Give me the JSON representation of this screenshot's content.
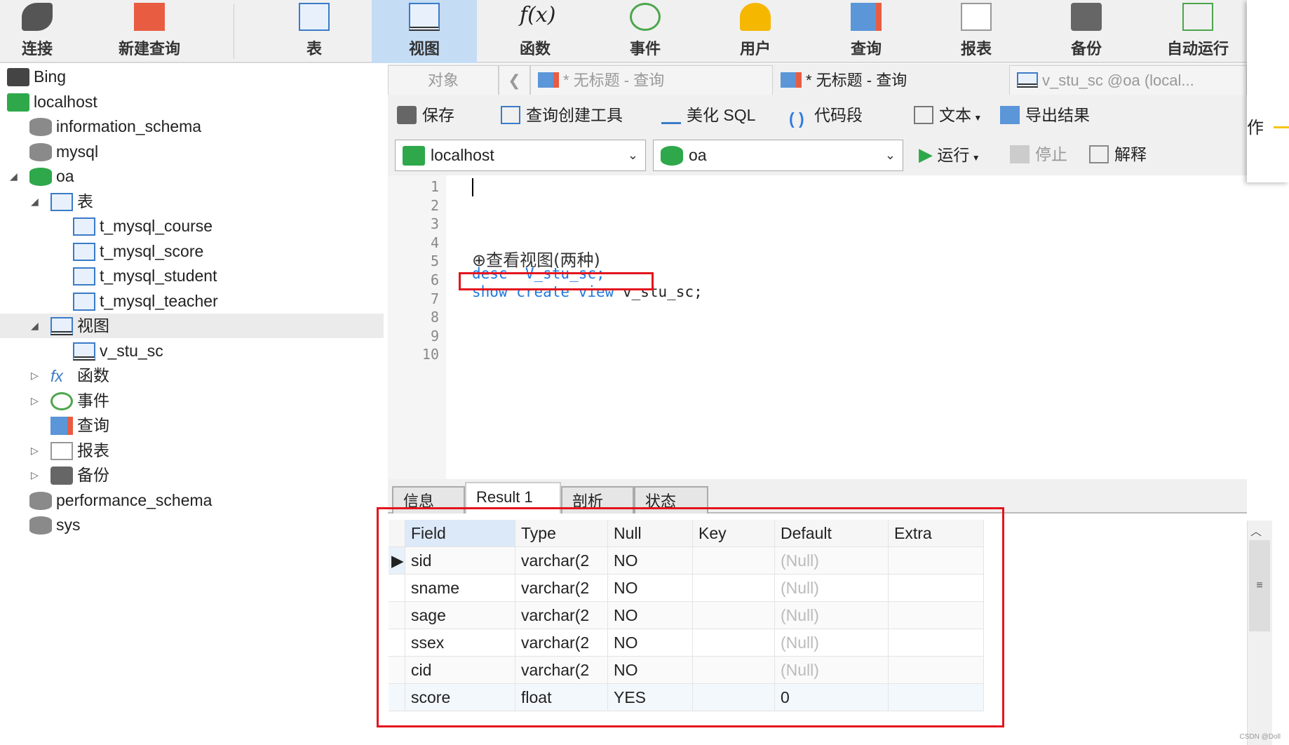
{
  "toolbar": {
    "items": [
      {
        "label": "连接",
        "icon": "plug-icon"
      },
      {
        "label": "新建查询",
        "icon": "new-query-icon"
      },
      {
        "label": "表",
        "icon": "table-icon"
      },
      {
        "label": "视图",
        "icon": "view-icon",
        "active": true
      },
      {
        "label": "函数",
        "icon": "function-icon"
      },
      {
        "label": "事件",
        "icon": "clock-icon"
      },
      {
        "label": "用户",
        "icon": "user-icon"
      },
      {
        "label": "查询",
        "icon": "query-icon"
      },
      {
        "label": "报表",
        "icon": "report-icon"
      },
      {
        "label": "备份",
        "icon": "backup-icon"
      },
      {
        "label": "自动运行",
        "icon": "schedule-icon"
      }
    ]
  },
  "sidebar": {
    "items": [
      {
        "label": "Bing",
        "level": 0,
        "icon": "connection-icon"
      },
      {
        "label": "localhost",
        "level": 0,
        "icon": "connection-active-icon"
      },
      {
        "label": "information_schema",
        "level": 1,
        "icon": "database-icon"
      },
      {
        "label": "mysql",
        "level": 1,
        "icon": "database-icon"
      },
      {
        "label": "oa",
        "level": 1,
        "icon": "database-open-icon",
        "expanded": true
      },
      {
        "label": "表",
        "level": 2,
        "icon": "table-icon",
        "expanded": true
      },
      {
        "label": "t_mysql_course",
        "level": 3,
        "icon": "table-icon"
      },
      {
        "label": "t_mysql_score",
        "level": 3,
        "icon": "table-icon"
      },
      {
        "label": "t_mysql_student",
        "level": 3,
        "icon": "table-icon"
      },
      {
        "label": "t_mysql_teacher",
        "level": 3,
        "icon": "table-icon"
      },
      {
        "label": "视图",
        "level": 2,
        "icon": "view-icon",
        "expanded": true,
        "selected": true
      },
      {
        "label": "v_stu_sc",
        "level": 3,
        "icon": "view-icon"
      },
      {
        "label": "函数",
        "level": 2,
        "icon": "function-icon",
        "collapsed": true
      },
      {
        "label": "事件",
        "level": 2,
        "icon": "clock-icon",
        "collapsed": true
      },
      {
        "label": "查询",
        "level": 2,
        "icon": "query-icon"
      },
      {
        "label": "报表",
        "level": 2,
        "icon": "report-icon",
        "collapsed": true
      },
      {
        "label": "备份",
        "level": 2,
        "icon": "backup-icon",
        "collapsed": true
      },
      {
        "label": "performance_schema",
        "level": 1,
        "icon": "database-icon"
      },
      {
        "label": "sys",
        "level": 1,
        "icon": "database-icon"
      }
    ]
  },
  "tabs": {
    "objects_label": "对象",
    "items": [
      {
        "label": "* 无标题 - 查询",
        "active": false
      },
      {
        "label": "* 无标题 - 查询",
        "active": true
      },
      {
        "label": "v_stu_sc @oa (local...",
        "active": false
      }
    ]
  },
  "query_toolbar": {
    "save": "保存",
    "builder": "查询创建工具",
    "beautify": "美化 SQL",
    "snippet": "代码段",
    "text": "文本",
    "export": "导出结果",
    "connection": "localhost",
    "database": "oa",
    "run": "运行",
    "stop": "停止",
    "explain": "解释"
  },
  "editor": {
    "line_numbers": [
      "1",
      "2",
      "3",
      "4",
      "5",
      "6",
      "7",
      "8",
      "9",
      "10"
    ],
    "comment": "⊕查看视图(两种)",
    "line6_kw": "desc",
    "line6_rest": "  V_stu_sc;",
    "line7_kw": "show create view",
    "line7_rest": " v_stu_sc;"
  },
  "results": {
    "tabs": [
      "信息",
      "Result 1",
      "剖析",
      "状态"
    ],
    "active_tab": "Result 1",
    "columns": [
      "Field",
      "Type",
      "Null",
      "Key",
      "Default",
      "Extra"
    ],
    "rows": [
      [
        "sid",
        "varchar(2",
        "NO",
        "",
        "(Null)",
        ""
      ],
      [
        "sname",
        "varchar(2",
        "NO",
        "",
        "(Null)",
        ""
      ],
      [
        "sage",
        "varchar(2",
        "NO",
        "",
        "(Null)",
        ""
      ],
      [
        "ssex",
        "varchar(2",
        "NO",
        "",
        "(Null)",
        ""
      ],
      [
        "cid",
        "varchar(2",
        "NO",
        "",
        "(Null)",
        ""
      ],
      [
        "score",
        "float",
        "YES",
        "",
        "0",
        ""
      ]
    ]
  },
  "side_panel": {
    "label": "作"
  },
  "watermark": "CSDN @Doll",
  "colors": {
    "highlight": "#c5dcf5",
    "keyword": "#1e78e0",
    "annotation": "#e4141e"
  }
}
